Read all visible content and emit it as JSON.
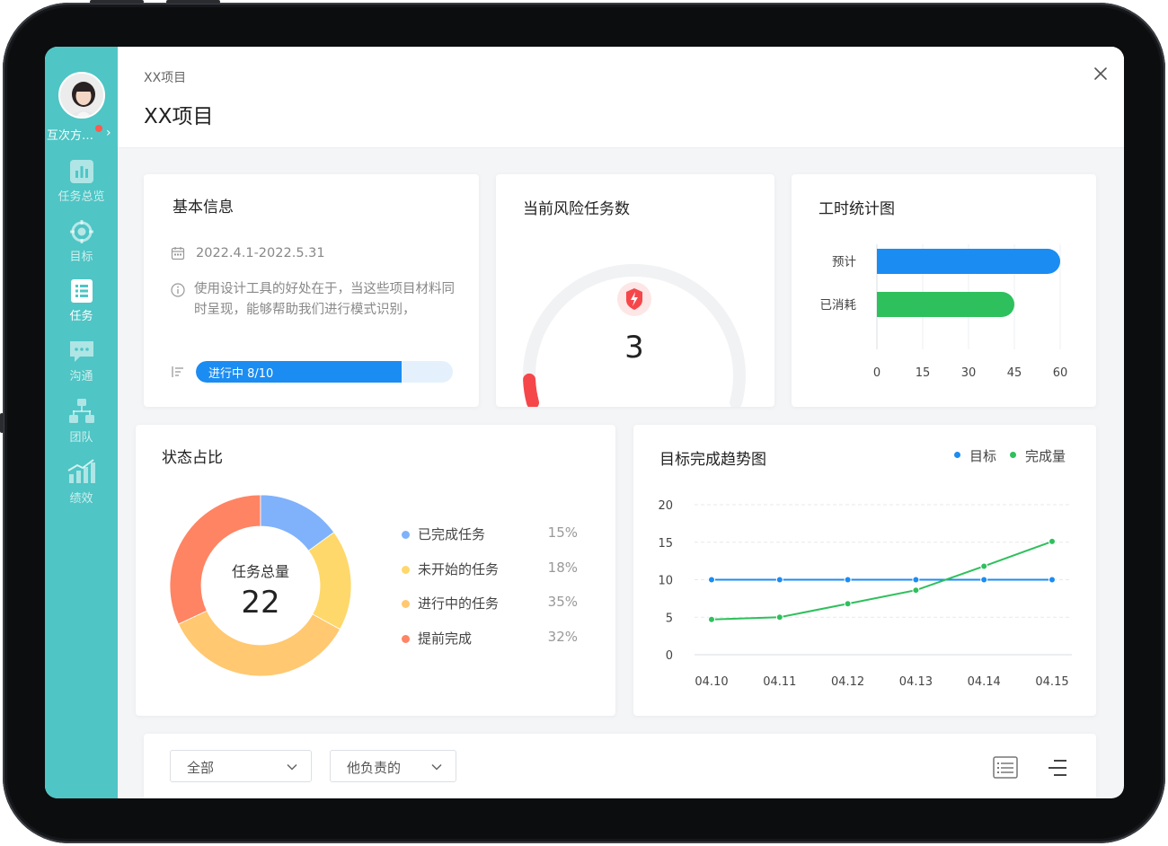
{
  "sidebar": {
    "user_name": "互次方…",
    "items": [
      {
        "label": "任务总览",
        "icon": "bar-chart-icon"
      },
      {
        "label": "目标",
        "icon": "target-icon"
      },
      {
        "label": "任务",
        "icon": "task-list-icon"
      },
      {
        "label": "沟通",
        "icon": "chat-icon"
      },
      {
        "label": "团队",
        "icon": "team-icon"
      },
      {
        "label": "绩效",
        "icon": "performance-icon"
      }
    ],
    "active_index": 2
  },
  "header": {
    "breadcrumb": "XX项目",
    "title": "XX项目"
  },
  "basic_info": {
    "title": "基本信息",
    "date_range": "2022.4.1-2022.5.31",
    "description": "使用设计工具的好处在于，当这些项目材料同时呈现，能够帮助我们进行模式识别，",
    "progress_label": "进行中 8/10",
    "progress_fraction": 0.8
  },
  "risk": {
    "title": "当前风险任务数",
    "count": "3",
    "gauge_fraction": 0.06,
    "colors": {
      "track": "#f1f2f4",
      "fill": "#f5474a",
      "badge_bg": "#fde6e6"
    }
  },
  "hours_chart": {
    "title": "工时统计图",
    "chart_data": {
      "type": "bar",
      "orientation": "horizontal",
      "categories": [
        "预计",
        "已消耗"
      ],
      "values": [
        60,
        45
      ],
      "xlim": [
        0,
        60
      ],
      "xticks": [
        "0",
        "15",
        "30",
        "45",
        "60"
      ],
      "colors": [
        "#1b8cf2",
        "#2ec05c"
      ],
      "grid": true
    }
  },
  "status_chart": {
    "title": "状态占比",
    "center_label": "任务总量",
    "center_value": "22",
    "chart_data": {
      "type": "pie",
      "donut": true,
      "slices": [
        {
          "name": "已完成任务",
          "value": 15,
          "pct": "15%",
          "color": "#7fb2fb"
        },
        {
          "name": "未开始的任务",
          "value": 18,
          "pct": "18%",
          "color": "#ffd86b"
        },
        {
          "name": "进行中的任务",
          "value": 35,
          "pct": "35%",
          "color": "#ffc871"
        },
        {
          "name": "提前完成",
          "value": 32,
          "pct": "32%",
          "color": "#ff8463"
        }
      ]
    }
  },
  "trend_chart": {
    "title": "目标完成趋势图",
    "chart_data": {
      "type": "line",
      "x": [
        "04.10",
        "04.11",
        "04.12",
        "04.13",
        "04.14",
        "04.15"
      ],
      "yticks": [
        "0",
        "5",
        "10",
        "15",
        "20"
      ],
      "ylim": [
        0,
        20
      ],
      "legend_position": "top-right",
      "series": [
        {
          "name": "目标",
          "values": [
            10,
            10,
            10,
            10,
            10,
            10
          ],
          "color": "#1b8cf2"
        },
        {
          "name": "完成量",
          "values": [
            4.7,
            5,
            6.8,
            8.6,
            11.8,
            15.1
          ],
          "color": "#2ec05c"
        }
      ]
    }
  },
  "filters": {
    "scope": "全部",
    "owner": "他负责的",
    "icons": [
      "list-view-icon",
      "sort-icon"
    ]
  }
}
